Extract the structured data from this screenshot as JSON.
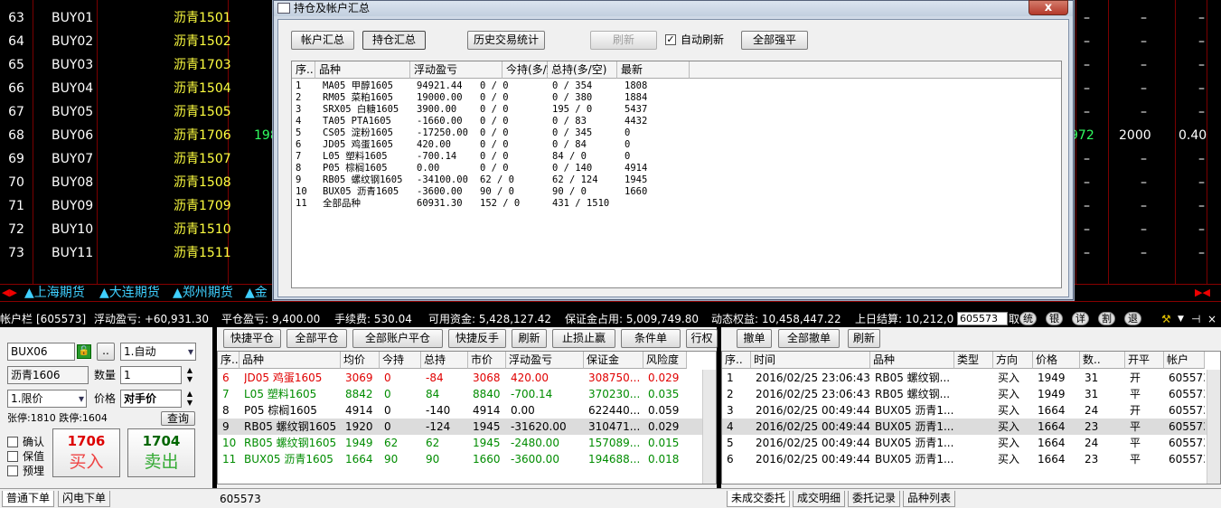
{
  "quote_rows": [
    {
      "n": "63",
      "code": "BUY01",
      "name": "沥青1501",
      "d1": "–",
      "d2": "–",
      "d3": "–"
    },
    {
      "n": "64",
      "code": "BUY02",
      "name": "沥青1502",
      "d1": "–",
      "d2": "–",
      "d3": "–"
    },
    {
      "n": "65",
      "code": "BUY03",
      "name": "沥青1703",
      "d1": "–",
      "d2": "–",
      "d3": "–"
    },
    {
      "n": "66",
      "code": "BUY04",
      "name": "沥青1504",
      "d1": "–",
      "d2": "–",
      "d3": "–"
    },
    {
      "n": "67",
      "code": "BUY05",
      "name": "沥青1505",
      "d1": "–",
      "d2": "–",
      "d3": "–"
    },
    {
      "n": "68",
      "code": "BUY06",
      "name": "沥青1706",
      "d0": "198",
      "d1": "972",
      "d2": "2000",
      "d3": "0.40"
    },
    {
      "n": "69",
      "code": "BUY07",
      "name": "沥青1507",
      "d1": "–",
      "d2": "–",
      "d3": "–"
    },
    {
      "n": "70",
      "code": "BUY08",
      "name": "沥青1508",
      "d1": "–",
      "d2": "–",
      "d3": "–"
    },
    {
      "n": "71",
      "code": "BUY09",
      "name": "沥青1709",
      "d1": "–",
      "d2": "–",
      "d3": "–"
    },
    {
      "n": "72",
      "code": "BUY10",
      "name": "沥青1510",
      "d1": "–",
      "d2": "–",
      "d3": "–"
    },
    {
      "n": "73",
      "code": "BUY11",
      "name": "沥青1511",
      "d1": "–",
      "d2": "–",
      "d3": "–"
    }
  ],
  "exchange_tabs": [
    "▲上海期货",
    "▲大连期货",
    "▲郑州期货",
    "▲金"
  ],
  "dialog": {
    "title": "持仓及帐户汇总",
    "close": "x",
    "buttons": {
      "account": "帐户汇总",
      "position": "持仓汇总",
      "history": "历史交易统计",
      "refresh": "刷新",
      "auto_refresh": "自动刷新",
      "close_all": "全部强平"
    },
    "columns": [
      "序..",
      "品种",
      "浮动盈亏",
      "今持(多/空)",
      "总持(多/空)",
      "最新"
    ],
    "rows": [
      [
        "1",
        "MA05 甲醇1605",
        "94921.44",
        "0 / 0",
        "0 / 354",
        "1808"
      ],
      [
        "2",
        "RM05 菜粕1605",
        "19000.00",
        "0 / 0",
        "0 / 380",
        "1884"
      ],
      [
        "3",
        "SRX05 白糖1605",
        "3900.00",
        "0 / 0",
        "195 / 0",
        "5437"
      ],
      [
        "4",
        "TA05 PTA1605",
        "-1660.00",
        "0 / 0",
        "0 / 83",
        "4432"
      ],
      [
        "5",
        "CS05 淀粉1605",
        "-17250.00",
        "0 / 0",
        "0 / 345",
        "0"
      ],
      [
        "6",
        "JD05 鸡蛋1605",
        "420.00",
        "0 / 0",
        "0 / 84",
        "0"
      ],
      [
        "7",
        "L05 塑料1605",
        "-700.14",
        "0 / 0",
        "84 / 0",
        "0"
      ],
      [
        "8",
        "P05 棕榈1605",
        "0.00",
        "0 / 0",
        "0 / 140",
        "4914"
      ],
      [
        "9",
        "RB05 螺纹钢1605",
        "-34100.00",
        "62 / 0",
        "62 / 124",
        "1945"
      ],
      [
        "10",
        "BUX05 沥青1605",
        "-3600.00",
        "90 / 0",
        "90 / 0",
        "1660"
      ],
      [
        "11",
        "全部品种",
        "60931.30",
        "152 / 0",
        "431 / 1510",
        ""
      ]
    ]
  },
  "account": {
    "label": "帐户栏",
    "id": "[605573]",
    "float_pl": "浮动盈亏: +60,931.30",
    "close_pl": "平仓盈亏: 9,400.00",
    "fee": "手续费: 530.04",
    "avail": "可用资金: 5,428,127.42",
    "margin": "保证金占用: 5,009,749.80",
    "equity": "动态权益: 10,458,447.22",
    "prev": "上日结算: 10,212,0",
    "select": "605573",
    "tail": "取",
    "icons": [
      "统",
      "银",
      "详",
      "割",
      "退"
    ]
  },
  "order": {
    "code": "BUX06",
    "mode": "1.自动",
    "name": "沥青1606",
    "qty_label": "数量",
    "qty": "1",
    "price_type": "1.限价",
    "price_label": "价格",
    "price": "对手价",
    "limits": "张停:1810 跌停:1604",
    "query": "查询",
    "confirm": "确认",
    "keep": "保值",
    "embed": "预埋",
    "buy_price": "1706",
    "buy": "买入",
    "sell_price": "1704",
    "sell": "卖出"
  },
  "trade_buttons": [
    "快捷平仓",
    "全部平仓",
    "全部账户平仓",
    "快捷反手",
    "刷新",
    "止损止赢",
    "条件单",
    "行权"
  ],
  "trade_columns": [
    "序..",
    "品种",
    "均价",
    "今持",
    "总持",
    "市价",
    "浮动盈亏",
    "保证金",
    "风险度"
  ],
  "trade_rows": [
    {
      "c": "red",
      "v": [
        "6",
        "JD05 鸡蛋1605",
        "3069",
        "0",
        "-84",
        "3068",
        "420.00",
        "308750...",
        "0.029"
      ]
    },
    {
      "c": "green",
      "v": [
        "7",
        "L05 塑料1605",
        "8842",
        "0",
        "84",
        "8840",
        "-700.14",
        "370230...",
        "0.035"
      ]
    },
    {
      "c": "black",
      "v": [
        "8",
        "P05 棕榈1605",
        "4914",
        "0",
        "-140",
        "4914",
        "0.00",
        "622440...",
        "0.059"
      ]
    },
    {
      "c": "black",
      "sel": true,
      "v": [
        "9",
        "RB05 螺纹钢1605",
        "1920",
        "0",
        "-124",
        "1945",
        "-31620.00",
        "310471...",
        "0.029"
      ]
    },
    {
      "c": "green",
      "v": [
        "10",
        "RB05 螺纹钢1605",
        "1949",
        "62",
        "62",
        "1945",
        "-2480.00",
        "157089...",
        "0.015"
      ]
    },
    {
      "c": "green",
      "u": true,
      "v": [
        "11",
        "BUX05 沥青1605",
        "1664",
        "90",
        "90",
        "1660",
        "-3600.00",
        "194688...",
        "0.018"
      ]
    }
  ],
  "deal_buttons": [
    "撤单",
    "全部撤单",
    "刷新"
  ],
  "deal_columns": [
    "序..",
    "时间",
    "品种",
    "类型",
    "方向",
    "价格",
    "数..",
    "开平",
    "帐户"
  ],
  "deal_rows": [
    [
      "1",
      "2016/02/25 23:06:43",
      "RB05 螺纹钢...",
      "",
      "买入",
      "1949",
      "31",
      "开",
      "605573"
    ],
    [
      "2",
      "2016/02/25 23:06:43",
      "RB05 螺纹钢...",
      "",
      "买入",
      "1949",
      "31",
      "平",
      "605573"
    ],
    [
      "3",
      "2016/02/25 00:49:44",
      "BUX05 沥青1...",
      "",
      "买入",
      "1664",
      "24",
      "开",
      "605573"
    ],
    [
      "4",
      "2016/02/25 00:49:44",
      "BUX05 沥青1...",
      "",
      "买入",
      "1664",
      "23",
      "平",
      "605573"
    ],
    [
      "5",
      "2016/02/25 00:49:44",
      "BUX05 沥青1...",
      "",
      "买入",
      "1664",
      "24",
      "平",
      "605573"
    ],
    [
      "6",
      "2016/02/25 00:49:44",
      "BUX05 沥青1...",
      "",
      "买入",
      "1664",
      "23",
      "平",
      "605573"
    ]
  ],
  "status_account": "605573",
  "bottom_left_tabs": [
    "普通下单",
    "闪电下单"
  ],
  "bottom_right_tabs": [
    "未成交委托",
    "成交明细",
    "委托记录",
    "品种列表"
  ]
}
